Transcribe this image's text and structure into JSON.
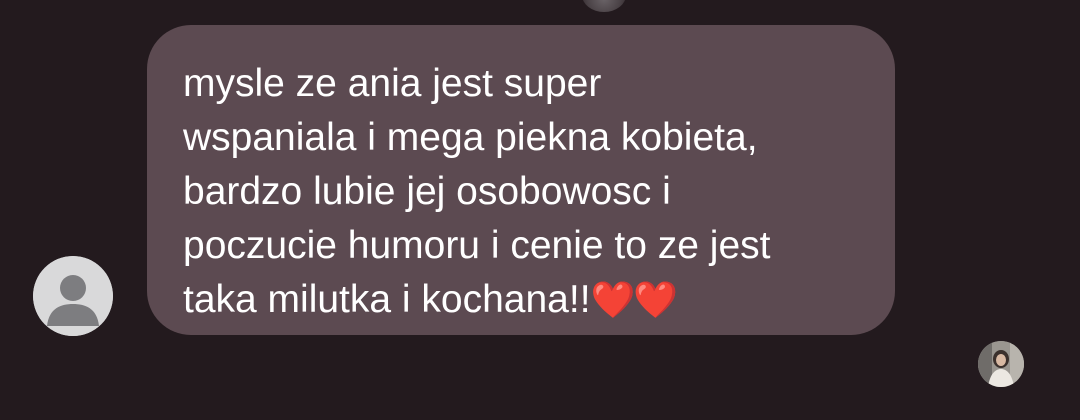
{
  "conversation": {
    "message": {
      "text": "mysle ze ania jest super\nwspaniala i mega piekna kobieta,\nbardzo lubie jej osobowosc i\npoczucie humoru i cenie to ze jest\ntaka milutka i kochana!!",
      "emoji": "❤️❤️"
    },
    "sender_avatar_icon": "default-user-icon",
    "seen_avatar_icon": "profile-photo"
  },
  "colors": {
    "background": "#231a1e",
    "bubble": "#5c4a51",
    "text": "#ffffff",
    "heart": "#e6212a"
  }
}
